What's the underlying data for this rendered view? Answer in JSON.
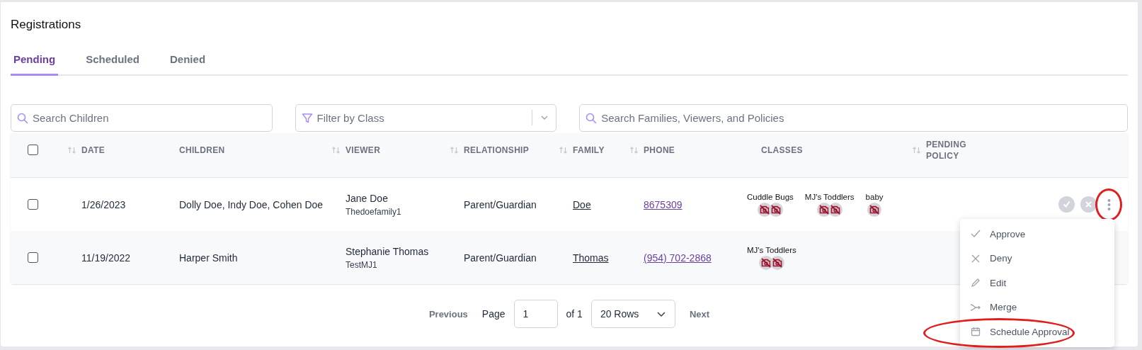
{
  "page": {
    "title": "Registrations"
  },
  "tabs": [
    {
      "label": "Pending",
      "selected": true
    },
    {
      "label": "Scheduled",
      "selected": false
    },
    {
      "label": "Denied",
      "selected": false
    }
  ],
  "filters": {
    "search_children": {
      "placeholder": "Search Children"
    },
    "class_filter": {
      "placeholder": "Filter by Class"
    },
    "search_families": {
      "placeholder": "Search Families, Viewers, and Policies"
    }
  },
  "table": {
    "select_all": {
      "checked": false
    },
    "columns": [
      {
        "label": "DATE",
        "sortable": true
      },
      {
        "label": "CHILDREN",
        "sortable": false
      },
      {
        "label": "VIEWER",
        "sortable": true
      },
      {
        "label": "RELATIONSHIP",
        "sortable": true
      },
      {
        "label": "FAMILY",
        "sortable": true
      },
      {
        "label": "PHONE",
        "sortable": true
      },
      {
        "label": "CLASSES",
        "sortable": false
      },
      {
        "label": "PENDING POLICY",
        "sortable": true
      }
    ],
    "rows": [
      {
        "checked": false,
        "date": "1/26/2023",
        "children": "Dolly Doe, Indy Doe, Cohen Doe",
        "viewer": "Jane Doe",
        "username": "Thedoefamily1",
        "relationship": "Parent/Guardian",
        "family": "Doe",
        "phone": "8675309",
        "classes": [
          {
            "name": "Cuddle Bugs",
            "cameras": [
              {
                "kind": "offline"
              },
              {
                "kind": "offline"
              }
            ]
          },
          {
            "name": "MJ's Toddlers",
            "cameras": [
              {
                "kind": "offline"
              },
              {
                "kind": "offline"
              }
            ]
          },
          {
            "name": "baby",
            "cameras": [
              {
                "kind": "offline"
              }
            ]
          }
        ],
        "actions": true,
        "more_circled": true
      },
      {
        "checked": false,
        "date": "11/19/2022",
        "children": "Harper Smith",
        "viewer": "Stephanie Thomas",
        "username": "TestMJ1",
        "relationship": "Parent/Guardian",
        "family": "Thomas",
        "phone": "(954) 702-2868",
        "classes": [
          {
            "name": "MJ's Toddlers",
            "cameras": [
              {
                "kind": "offline"
              },
              {
                "kind": "offline"
              }
            ]
          }
        ],
        "actions": false
      }
    ]
  },
  "row_menu": {
    "items": [
      {
        "kind": "check",
        "label": "Approve",
        "circled": false
      },
      {
        "kind": "cross",
        "label": "Deny",
        "circled": false
      },
      {
        "kind": "pencil",
        "label": "Edit",
        "circled": false
      },
      {
        "kind": "merge",
        "label": "Merge",
        "circled": false
      },
      {
        "kind": "calendar",
        "label": "Schedule Approval",
        "circled": true
      }
    ]
  },
  "pagination": {
    "previous": "Previous",
    "page_label": "Page",
    "page": "1",
    "of": "of 1",
    "rows": "20 Rows",
    "next": "Next"
  }
}
